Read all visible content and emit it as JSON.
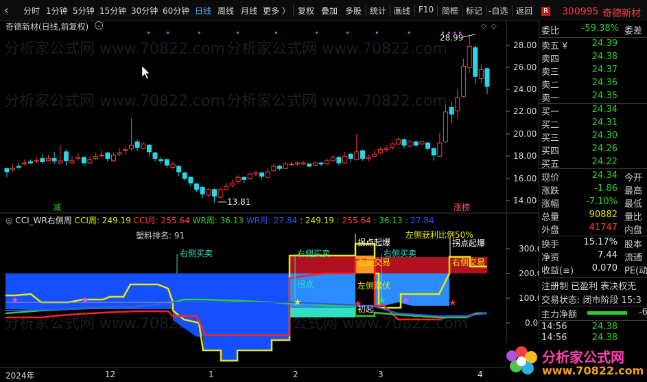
{
  "toolbar": {
    "back_label": "‹",
    "items": [
      "分时",
      "1分钟",
      "5分钟",
      "15分钟",
      "30分钟",
      "60分钟",
      "日线",
      "周线",
      "月线",
      "更多 〉",
      "复权",
      "叠加",
      "多股",
      "统计",
      "画线",
      "F10",
      "简框",
      "标记",
      "-自选",
      "返回"
    ],
    "active_index": 6
  },
  "stock": {
    "title": "奇德新材(日线,前复权)",
    "code": "300995",
    "name": "奇德新材",
    "code_badge": "R"
  },
  "price_axis": [
    "28.00",
    "26.00",
    "24.00",
    "22.00",
    "20.00",
    "18.00",
    "16.00",
    "14.00"
  ],
  "price_annotations": {
    "high": "28.99",
    "low": "13.81",
    "tag_left": "减",
    "tag_right": "涨榜"
  },
  "indicator": {
    "title": "CCI_WR右侧周",
    "parts": [
      {
        "text": "CCI周: 249.19",
        "color": "#e8e800"
      },
      {
        "text": "CCI月: 255.64",
        "color": "#ff3d3d"
      },
      {
        "text": "WR周: 36.13",
        "color": "#2ad02a"
      },
      {
        "text": "WR月: 27.84",
        "color": "#3050ff"
      },
      {
        "text": ": 249.19",
        "color": "#e8e800"
      },
      {
        "text": ": 255.64",
        "color": "#ff3d3d"
      },
      {
        "text": ": 36.13",
        "color": "#2ad02a"
      },
      {
        "text": ": 27.84",
        "color": "#3050ff"
      }
    ],
    "rank_label": "塑料排名:  91",
    "axis": [
      "300.00",
      "200.00",
      "100.00",
      "0.00"
    ],
    "annotations": {
      "right_buy_1": "右侧买卖",
      "right_buy_2": "右侧买卖",
      "right_buy_3": "右侧买卖",
      "turn_1": "拐点",
      "turn_burst_1": "拐点起爆",
      "turn_burst_2": "拐点起爆",
      "right_trade_1": "右侧交易",
      "right_trade_2": "右侧交易",
      "left_ambush": "左侧潜伏",
      "first_up": "初起",
      "left_profit": "左侧获利比例50%"
    }
  },
  "date_axis": [
    "2024年",
    "12",
    "1",
    "2",
    "3",
    "4"
  ],
  "order_book": {
    "committee_ratio_label": "委比",
    "committee_ratio": "-59.38%",
    "committee_diff_label": "委差",
    "sells": [
      {
        "label": "卖五 ¥",
        "price": "24.39"
      },
      {
        "label": "卖四",
        "price": "24.38"
      },
      {
        "label": "卖三",
        "price": "24.37"
      },
      {
        "label": "卖二",
        "price": "24.36"
      },
      {
        "label": "卖一",
        "price": "24.35"
      }
    ],
    "buys": [
      {
        "label": "买一",
        "price": "24.34"
      },
      {
        "label": "买二",
        "price": "24.31"
      },
      {
        "label": "买三",
        "price": "24.30"
      },
      {
        "label": "买四",
        "price": "24.26"
      },
      {
        "label": "买五",
        "price": "24.22"
      }
    ]
  },
  "quote": [
    {
      "label": "现价",
      "value": "24.34",
      "cls": "green",
      "label2": "今开"
    },
    {
      "label": "涨跌",
      "value": "-1.86",
      "cls": "green",
      "label2": "最高"
    },
    {
      "label": "涨幅",
      "value": "-7.10%",
      "cls": "green",
      "label2": "最低"
    },
    {
      "label": "总量",
      "value": "90882",
      "cls": "yellow",
      "label2": "量比"
    },
    {
      "label": "外盘",
      "value": "41747",
      "cls": "red",
      "label2": "内盘"
    }
  ],
  "stats": [
    {
      "label": "换手",
      "value": "15.17%",
      "label2": "股本"
    },
    {
      "label": "净资",
      "value": "7.44",
      "label2": "流通"
    },
    {
      "label": "收益(≡)",
      "value": "0.070",
      "label2": "PE(动"
    }
  ],
  "flags": {
    "line1": "注册制 已盈利 表决权无",
    "line2": "交易状态: 闭市阶段 15:3",
    "main_flow_label": "主力净额",
    "main_flow_value": "-6"
  },
  "ticks": [
    {
      "time": "14:56",
      "price": "24.38"
    },
    {
      "time": "14:56",
      "price": "24.38"
    },
    {
      "time": "14:57",
      "price": "24.3"
    }
  ],
  "watermark": "分析家公式网 www.70822.com",
  "logo": {
    "title": "分析家公式网",
    "url": "www.70822.com"
  },
  "colors": {
    "up": "#ff3d3d",
    "down": "#29d6e6",
    "blue_fill": "#1450ff",
    "red_fill": "#b01020"
  }
}
